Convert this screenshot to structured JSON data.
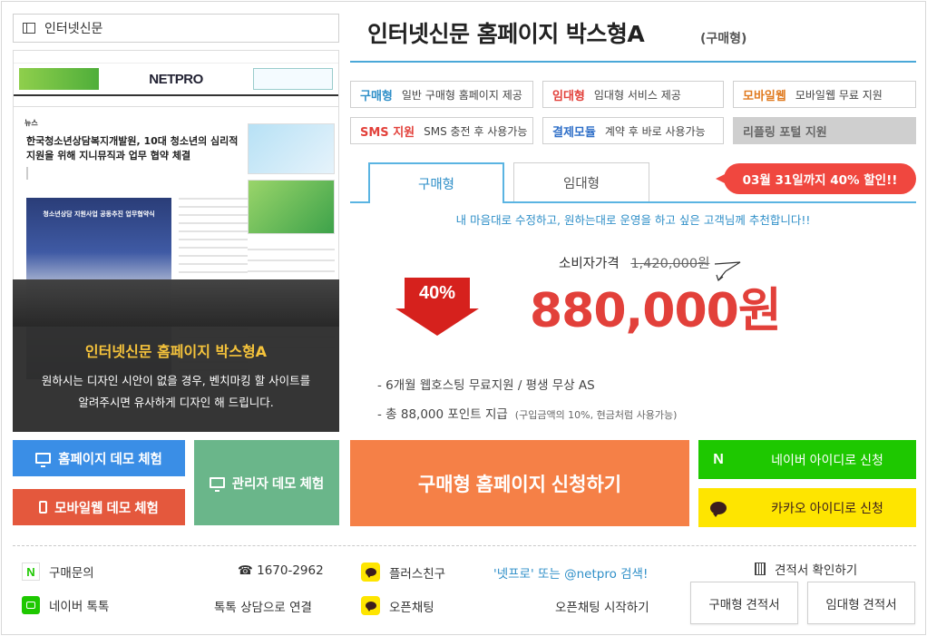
{
  "category": {
    "label": "인터넷신문"
  },
  "preview": {
    "logo": "NETPRO",
    "section": "뉴스",
    "headline": "한국청소년상담복지개발원, 10대 청소년의 심리적 지원을 위해 지니뮤직과 업무 협약 체결",
    "photo_caption": "청소년상담 지원사업 공동추진 업무협약식",
    "overlay_title": "인터넷신문 홈페이지 박스형A",
    "overlay_desc_1": "원하시는 디자인 시안이 없을 경우, 벤치마킹 할 사이트를",
    "overlay_desc_2": "알려주시면 유사하게 디자인 해 드립니다."
  },
  "product": {
    "title": "인터넷신문 홈페이지 박스형A",
    "type": "(구매형)"
  },
  "features": [
    {
      "key": "구매형",
      "desc": "일반 구매형 홈페이지 제공",
      "color": "#2f8fc8"
    },
    {
      "key": "임대형",
      "desc": "임대형 서비스 제공",
      "color": "#e2403a"
    },
    {
      "key": "모바일웹",
      "desc": "모바일웹 무료 지원",
      "color": "#e07a1f"
    },
    {
      "key": "SMS 지원",
      "desc": "SMS 충전 후 사용가능",
      "color": "#e2403a"
    },
    {
      "key": "결제모듈",
      "desc": "계약 후 바로 사용가능",
      "color": "#2f6fc8"
    },
    {
      "key": "리플링 포털 지원",
      "desc": "",
      "color": "#666666"
    }
  ],
  "tabs": {
    "buy": "구매형",
    "rent": "임대형"
  },
  "promo": "03월 31일까지 40% 할인!!",
  "recommend": "내 마음대로 수정하고, 원하는대로 운영을 하고 싶은 고객님께 추천합니다!!",
  "pricing": {
    "discount": "40%",
    "consumer_label": "소비자가격",
    "consumer_price": "1,420,000원",
    "sale_price": "880,000원"
  },
  "benefits": [
    {
      "text": "- 6개월 웹호스팅 무료지원 / 평생 무상 AS",
      "note": ""
    },
    {
      "text": "- 총 88,000 포인트 지급",
      "note": "(구입금액의 10%, 현금처럼 사용가능)"
    }
  ],
  "buttons": {
    "demo_home": "홈페이지 데모 체험",
    "demo_mobile": "모바일웹 데모 체험",
    "demo_admin": "관리자 데모 체험",
    "apply": "구매형 홈페이지 신청하기",
    "naver": "네이버 아이디로 신청",
    "kakao": "카카오 아이디로 신청"
  },
  "contact": {
    "inquiry": "구매문의",
    "phone": "☎ 1670-2962",
    "plusfriend": "플러스친구",
    "search_hint": "'넷프로' 또는 @netpro 검색!",
    "talk": "네이버 톡톡",
    "talk_link": "톡톡 상담으로 연결",
    "openchat": "오픈채팅",
    "openchat_link": "오픈채팅 시작하기",
    "quote_check": "견적서 확인하기",
    "quote_buy": "구매형 견적서",
    "quote_rent": "임대형 견적서"
  },
  "colors": {
    "accent": "#4aa8d8",
    "sale": "#e2403a",
    "naver": "#1ec800",
    "kakao": "#fee500",
    "apply": "#f58047"
  }
}
